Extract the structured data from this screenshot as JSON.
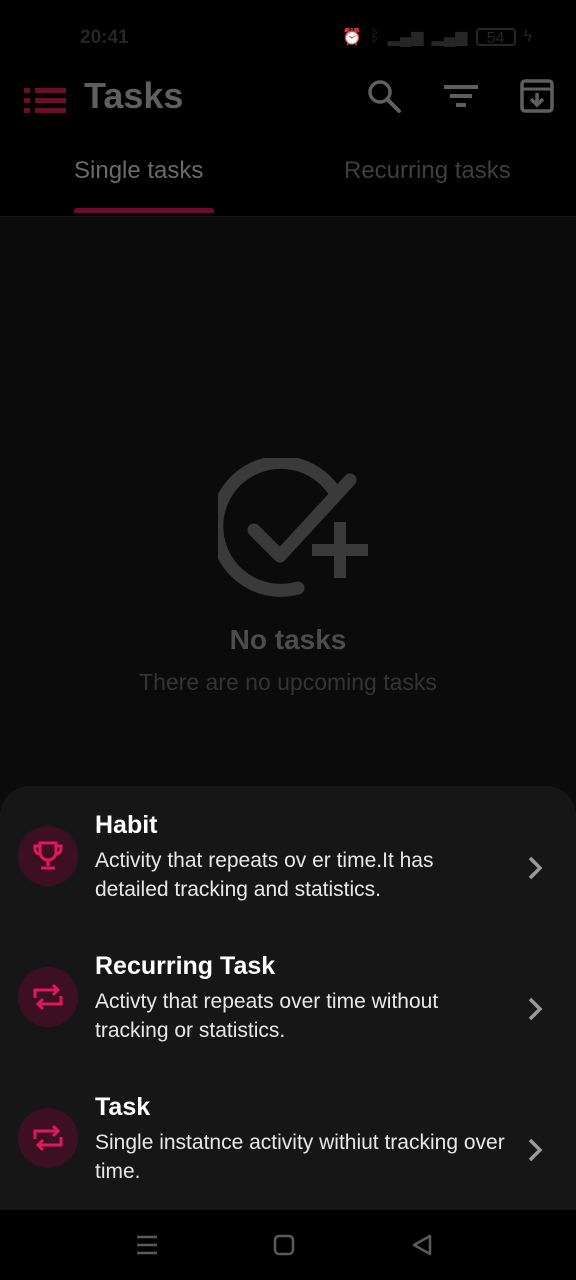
{
  "status_bar": {
    "time": "20:41",
    "battery": "54"
  },
  "app_bar": {
    "title": "Tasks"
  },
  "tabs": [
    {
      "label": "Single tasks",
      "active": true
    },
    {
      "label": "Recurring tasks",
      "active": false
    }
  ],
  "empty_state": {
    "title": "No tasks",
    "subtitle": "There are no upcoming tasks"
  },
  "sheet": {
    "options": [
      {
        "title": "Habit",
        "description": "Activity that repeats ov er time.It has detailed tracking and statistics.",
        "icon": "trophy-icon"
      },
      {
        "title": "Recurring Task",
        "description": "Activty that repeats over time without tracking or statistics.",
        "icon": "repeat-icon"
      },
      {
        "title": "Task",
        "description": "Single instatnce activity withiut tracking over time.",
        "icon": "repeat-icon"
      }
    ]
  },
  "colors": {
    "accent": "#e0195a",
    "accent_dim": "#3c1021",
    "background": "#0b0b0b",
    "sheet": "#161616"
  }
}
